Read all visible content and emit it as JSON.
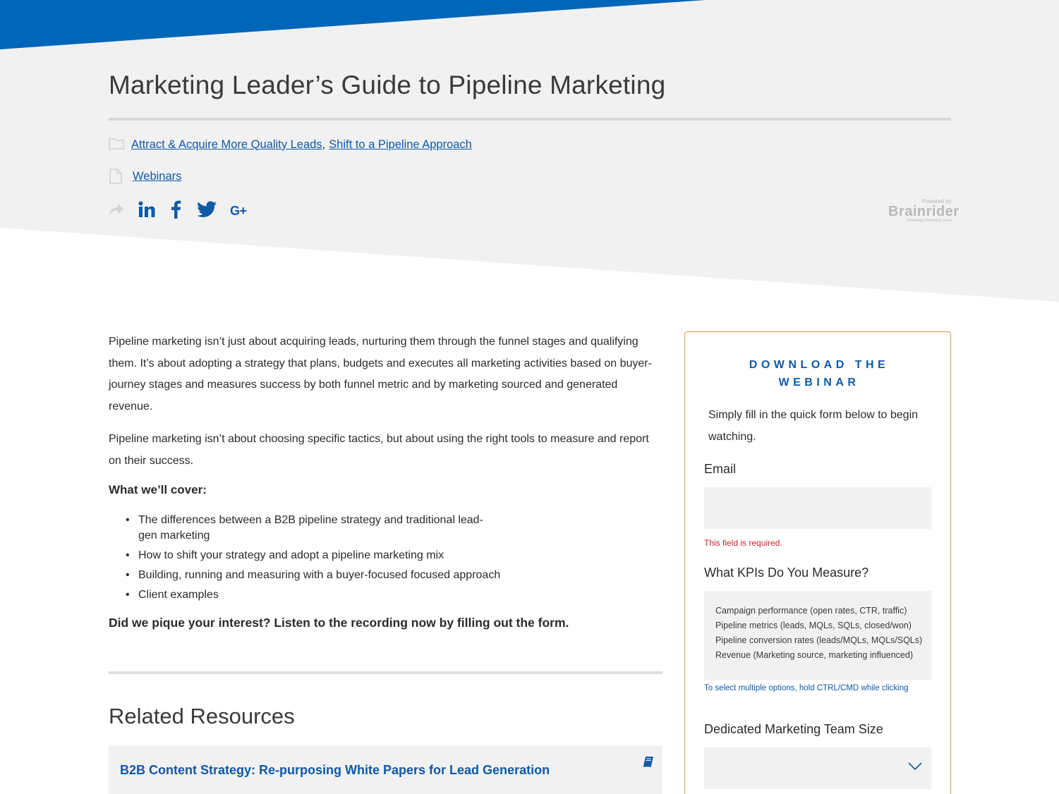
{
  "header": {
    "title": "Marketing Leader’s Guide to Pipeline Marketing",
    "categories": [
      "Attract & Acquire More Quality Leads",
      "Shift to a Pipeline Approach"
    ],
    "category_separator": ",",
    "types": [
      "Webinars"
    ],
    "icons": {
      "category": "folder-icon",
      "type": "document-icon",
      "share": "share-arrow-icon"
    },
    "share": [
      {
        "name": "linkedin-icon"
      },
      {
        "name": "facebook-icon"
      },
      {
        "name": "twitter-icon"
      },
      {
        "name": "google-plus-icon",
        "glyph": "G+"
      }
    ],
    "brand": {
      "powered": "Powered by",
      "name": "Brainrider",
      "tag": "Knowledge Marketing Group"
    }
  },
  "article": {
    "paragraphs": [
      "Pipeline marketing isn’t just about acquiring leads, nurturing them through the funnel stages and qualifying them. It’s about adopting a strategy that plans, budgets and executes all marketing activities based on buyer-journey stages and measures success by both funnel metric and by marketing sourced and generated revenue.",
      "Pipeline marketing isn’t about choosing specific tactics, but about using the right tools to measure and report on their success."
    ],
    "cover_heading": "What we’ll cover:",
    "cover_items": [
      "The differences between a B2B pipeline strategy and traditional lead-gen marketing",
      "How to shift your strategy and adopt a pipeline marketing mix",
      "Building, running and measuring with a buyer-focused focused approach",
      "Client examples"
    ],
    "cta": "Did we pique your interest? Listen to the recording now by filling out the form."
  },
  "related": {
    "title": "Related Resources",
    "items": [
      {
        "title": "B2B Content Strategy: Re-purposing White Papers for Lead Generation",
        "icon": "book-icon"
      }
    ]
  },
  "form": {
    "heading": "DOWNLOAD THE WEBINAR",
    "intro": "Simply fill in the quick form below to begin watching.",
    "email_label": "Email",
    "email_value": "",
    "email_error": "This field is required.",
    "kpi_label": "What KPIs Do You Measure?",
    "kpi_options": [
      "Campaign performance (open rates, CTR, traffic)",
      "Pipeline metrics (leads, MQLs, SQLs, closed/won)",
      "Pipeline conversion rates (leads/MQLs, MQLs/SQLs)",
      "Revenue (Marketing source, marketing influenced)"
    ],
    "kpi_help": "To select multiple options, hold CTRL/CMD while clicking",
    "team_label": "Dedicated Marketing Team Size",
    "team_value": ""
  },
  "colors": {
    "brand_blue": "#0066b8",
    "link_blue": "#0e5aa7",
    "hero_gray": "#f1f1f1",
    "form_border": "#f39a44",
    "error_red": "#d0202f"
  }
}
